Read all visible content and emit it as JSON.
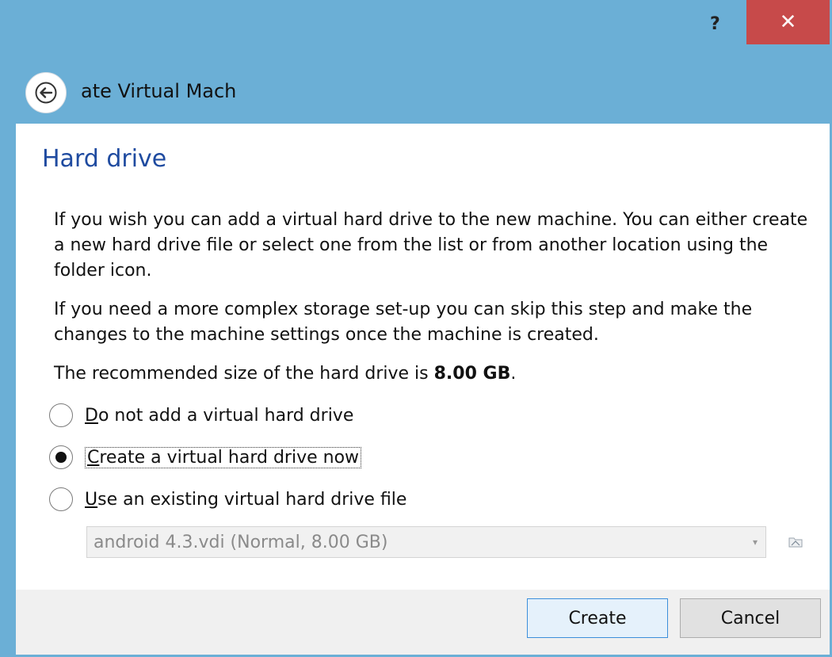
{
  "titlebar": {
    "help_label": "?",
    "close_label": "✕"
  },
  "header": {
    "title": "ate Virtual Mach",
    "back_icon": "back-arrow-icon"
  },
  "page": {
    "heading": "Hard drive",
    "paragraph1": "If you wish you can add a virtual hard drive to the new machine. You can either create a new hard drive file or select one from the list or from another location using the folder icon.",
    "paragraph2": "If you need a more complex storage set-up you can skip this step and make the changes to the machine settings once the machine is created.",
    "recommended_prefix": "The recommended size of the hard drive is ",
    "recommended_size": "8.00 GB",
    "recommended_suffix": "."
  },
  "options": [
    {
      "mnemonic": "D",
      "rest": "o not add a virtual hard drive",
      "selected": false
    },
    {
      "mnemonic": "C",
      "rest": "reate a virtual hard drive now",
      "selected": true
    },
    {
      "mnemonic": "U",
      "rest": "se an existing virtual hard drive file",
      "selected": false
    }
  ],
  "existing_file": {
    "value": "android 4.3.vdi (Normal, 8.00 GB)",
    "enabled": false
  },
  "buttons": {
    "create": "Create",
    "cancel": "Cancel"
  },
  "colors": {
    "titlebar": "#6bafd6",
    "close": "#c74a4a",
    "heading": "#1f4ba0"
  }
}
